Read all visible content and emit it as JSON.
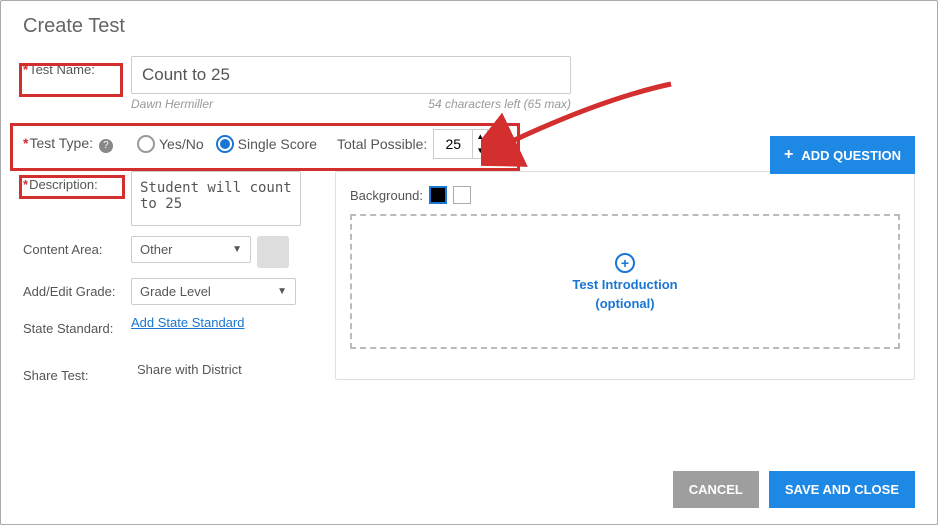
{
  "title": "Create Test",
  "labels": {
    "test_name": "Test Name:",
    "test_type": "Test Type:",
    "description": "Description:",
    "content_area": "Content Area:",
    "grade": "Add/Edit Grade:",
    "state_standard": "State Standard:",
    "share_test": "Share Test:",
    "total_possible": "Total Possible:"
  },
  "fields": {
    "test_name_value": "Count to 25",
    "author": "Dawn Hermiller",
    "chars_left": "54 characters left (65 max)",
    "type_options": {
      "yesno": "Yes/No",
      "single": "Single Score"
    },
    "total_possible_value": "25",
    "description_value": "Student will count to 25",
    "content_area_selected": "Other",
    "grade_selected": "Grade Level",
    "state_standard_link": "Add State Standard",
    "share_label": "Share with District"
  },
  "right": {
    "background_label": "Background:",
    "intro_line1": "Test Introduction",
    "intro_line2": "(optional)"
  },
  "buttons": {
    "add_question": "ADD QUESTION",
    "cancel": "CANCEL",
    "save": "SAVE AND CLOSE"
  }
}
